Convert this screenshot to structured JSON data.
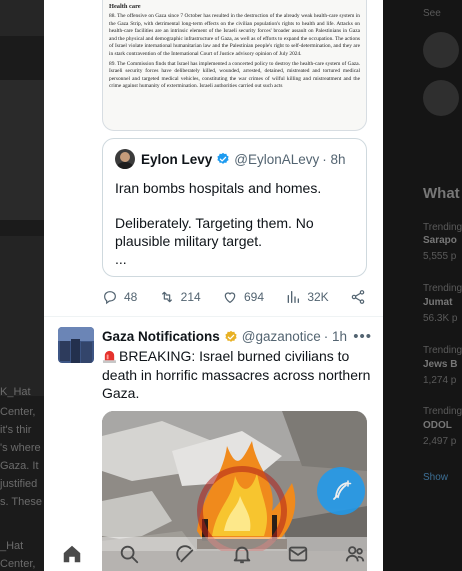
{
  "background_left": {
    "lines": [
      "Center,",
      "it's thir",
      "'s where",
      "Gaza. It",
      "justified",
      "s. These",
      "_Hat",
      "Center,",
      "K_Hat"
    ]
  },
  "background_right": {
    "top_label": "See",
    "whats_label": "What",
    "trending": [
      {
        "category": "Trending",
        "topic": "Sarapo",
        "count": "5,555 p"
      },
      {
        "category": "Trending",
        "topic": "Jumat",
        "count": "56.3K p"
      },
      {
        "category": "Trending",
        "topic": "Jews B",
        "count": "1,274 p"
      },
      {
        "category": "Trending",
        "topic": "ODOL",
        "count": "2,497 p"
      }
    ],
    "show_more": "Show"
  },
  "document": {
    "heading": "Health care",
    "para88": "88.  The offensive on Gaza since 7 October has resulted in the destruction of the already weak health-care system in the Gaza Strip, with detrimental long-term effects on the civilian population's rights to health and life. Attacks on health-care facilities are an intrinsic element of the Israeli security forces' broader assault on Palestinians in Gaza and the physical and demographic infrastructure of Gaza, as well as of efforts to expand the occupation. The actions of Israel violate international humanitarian law and the Palestinian people's right to self-determination, and they are in stark contravention of the International Court of Justice advisory opinion of July 2024.",
    "para89": "89.  The Commission finds that Israel has implemented a concerted policy to destroy the health-care system of Gaza. Israeli security forces have deliberately killed, wounded, arrested, detained, mistreated and tortured medical personnel and targeted medical vehicles, constituting the war crimes of wilful killing and mistreatment and the crime against humanity of extermination. Israeli authorities carried out such acts"
  },
  "quoted_tweet": {
    "name": "Eylon Levy",
    "handle": "@EylonALevy",
    "time": "· 8h",
    "line1": "Iran bombs hospitals and homes.",
    "line2": "Deliberately. Targeting them. No plausible military target.",
    "line3": "..."
  },
  "actions": {
    "replies": "48",
    "reposts": "214",
    "likes": "694",
    "views": "32K"
  },
  "tweet2": {
    "name": "Gaza Notifications",
    "handle": "@gazanotice",
    "time": "· 1h",
    "more": "•••",
    "text": "BREAKING: Israel burned civilians to death in horrific massacres across northern Gaza."
  },
  "colors": {
    "accent": "#1d9bf0",
    "verified_gold": "#e8b125",
    "text_primary": "#0f1419",
    "text_secondary": "#536471"
  },
  "icons": {
    "reply": "speech-bubble-icon",
    "repost": "repost-arrows-icon",
    "like": "heart-icon",
    "views": "bar-chart-icon",
    "share": "share-icon",
    "compose": "feather-plus-icon",
    "nav": [
      "home-icon",
      "search-icon",
      "grok-icon",
      "bell-icon",
      "mail-icon",
      "people-icon"
    ]
  }
}
